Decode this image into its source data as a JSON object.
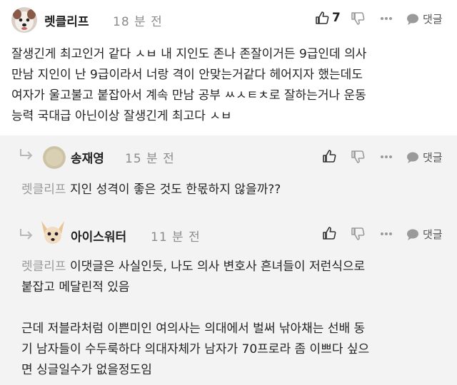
{
  "comments": [
    {
      "author": "렛클리프",
      "time": "18 분 전",
      "like_count": "7",
      "reply_label": "댓글",
      "avatar_icon": "dog-face-avatar-icon",
      "text": "잘생긴게 최고인거 같다 ㅅㅂ 내 지인도 존나 존잘이거든 9급인데 의사\n만남 지인이 난 9급이라서 너랑 격이 안맞는거같다 헤어지자 했는데도\n여자가 울고불고 붙잡아서 계속 만남 공부 ㅆㅅㅌㅊ로 잘하는거나 운동\n능력 국대급 아닌이상 잘생긴게 최고다 ㅅㅂ"
    },
    {
      "author": "송재영",
      "time": "15 분 전",
      "reply_label": "댓글",
      "avatar_icon": "beige-circle-avatar-icon",
      "mention": "렛클리프",
      "text": " 지인 성격이 좋은 것도 한몫하지 않을까??"
    },
    {
      "author": "아이스워터",
      "time": "11 분 전",
      "reply_label": "댓글",
      "avatar_icon": "chihuahua-avatar-icon",
      "mention": "렛클리프",
      "text_line1": " 이댓글은 사실인듯, 나도 의사 변호사 흔녀들이 저런식으로",
      "text_rest": "붙잡고 메달린적 있음\n\n근데 저블라처럼 이쁜미인 여의사는 의대에서 벌써 낚아채는 선배 동\n기 남자들이 수두룩하다 의대자체가 남자가 70프로라 좀 이쁘다 싶으\n면 싱글일수가 없을정도임"
    }
  ],
  "colors": {
    "reply_bg": "#f3f3f3",
    "mention": "#9a9a9a",
    "meta": "#8b8b8b"
  }
}
